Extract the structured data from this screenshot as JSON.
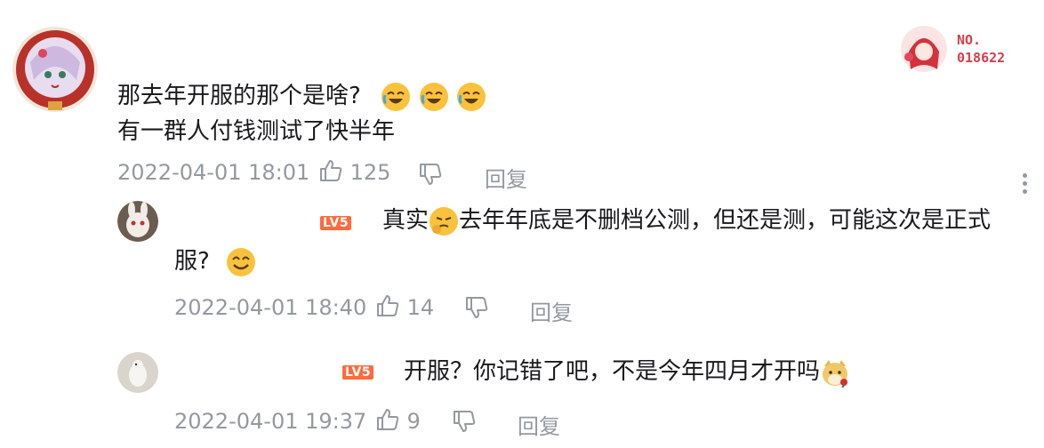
{
  "comment": {
    "line1": "那去年开服的那个是啥?",
    "line2": "有一群人付钱测试了快半年",
    "time": "2022-04-01 18:01",
    "likes": "125",
    "reply_label": "回复",
    "badge_no": "NO.",
    "badge_num": "018622"
  },
  "replies": [
    {
      "level": "LV5",
      "text_a": "真实",
      "text_b": "去年年底是不删档公测，但还是测，可能这次是正式",
      "text_c": "服?",
      "time": "2022-04-01 18:40",
      "likes": "14",
      "reply_label": "回复"
    },
    {
      "level": "LV5",
      "text_a": "开服？你记错了吧，不是今年四月才开吗",
      "time": "2022-04-01 19:37",
      "likes": "9",
      "reply_label": "回复"
    }
  ],
  "colors": {
    "level_badge": "#ff6a3d",
    "meta": "#9499a0",
    "text": "#18191c"
  }
}
